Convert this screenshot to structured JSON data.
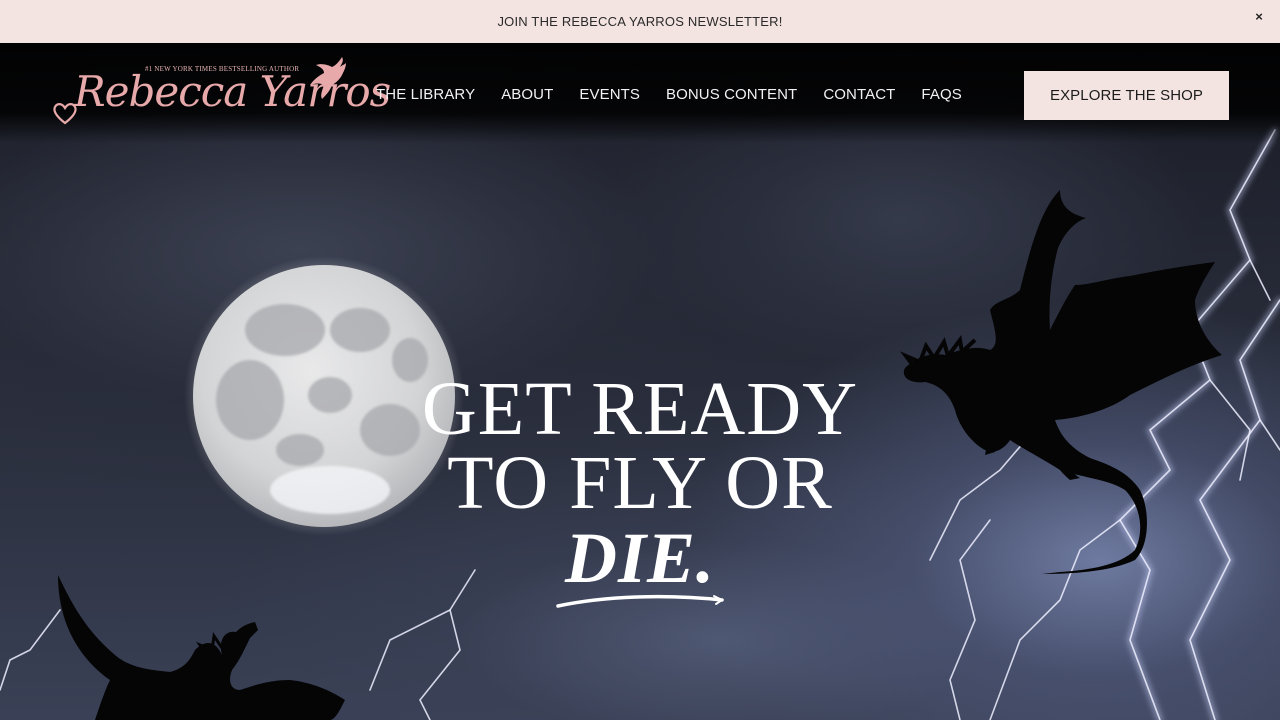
{
  "announcement": {
    "text": "JOIN THE REBECCA YARROS NEWSLETTER!",
    "close_icon": "close-icon",
    "close_glyph": "×"
  },
  "logo": {
    "tagline": "#1 NEW YORK TIMES BESTSELLING AUTHOR",
    "name": "Rebecca Yarros",
    "color": "#e8a9aa"
  },
  "nav": {
    "items": [
      {
        "label": "THE LIBRARY"
      },
      {
        "label": "ABOUT"
      },
      {
        "label": "EVENTS"
      },
      {
        "label": "BONUS CONTENT"
      },
      {
        "label": "CONTACT"
      },
      {
        "label": "FAQS"
      }
    ]
  },
  "shop_button": {
    "label": "EXPLORE THE SHOP",
    "background": "#f4e4e1"
  },
  "hero": {
    "line1": "GET READY",
    "line2": "TO FLY OR",
    "line3": "DIE."
  },
  "colors": {
    "accent": "#f4e4e1",
    "logo_pink": "#e8a9aa",
    "sky_dark": "#1c1f2a"
  }
}
